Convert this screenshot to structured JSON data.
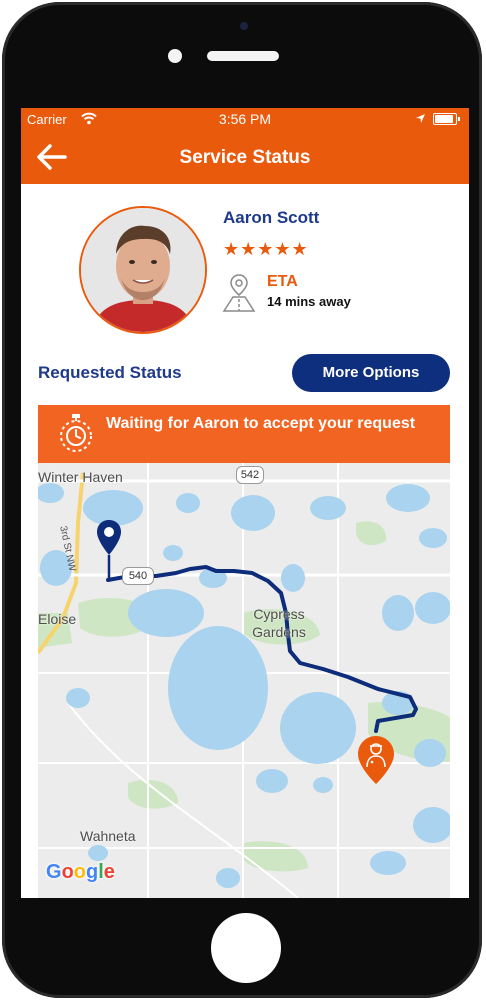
{
  "status_bar": {
    "carrier": "Carrier",
    "time": "3:56 PM"
  },
  "nav": {
    "title": "Service Status",
    "back_icon": "back-arrow-icon"
  },
  "driver": {
    "name": "Aaron Scott",
    "rating": 5,
    "stars_text": "★★★★★",
    "eta_label": "ETA",
    "eta_value": "14 mins away"
  },
  "status": {
    "title": "Requested Status",
    "more_options_label": "More Options"
  },
  "banner": {
    "text": "Waiting for Aaron to accept your request",
    "icon": "stopwatch-icon"
  },
  "map": {
    "labels": {
      "winter_haven": "Winter Haven",
      "eloise": "Eloise",
      "cypress_gardens": "Cypress Gardens",
      "wahneta": "Wahneta",
      "road_542": "542",
      "road_540": "540",
      "road_3rd": "3rd St NW",
      "google": "Google"
    },
    "markers": {
      "start": "location-pin-icon",
      "driver": "driver-pin-icon"
    }
  },
  "colors": {
    "brand_orange": "#ea5a0c",
    "navy": "#0e2f7e",
    "title_blue": "#1f3a8a",
    "banner_orange": "#f26422",
    "route": "#0d2c7a",
    "water": "#a9d3ee",
    "land": "#ececec",
    "park": "#cfe6c4"
  }
}
